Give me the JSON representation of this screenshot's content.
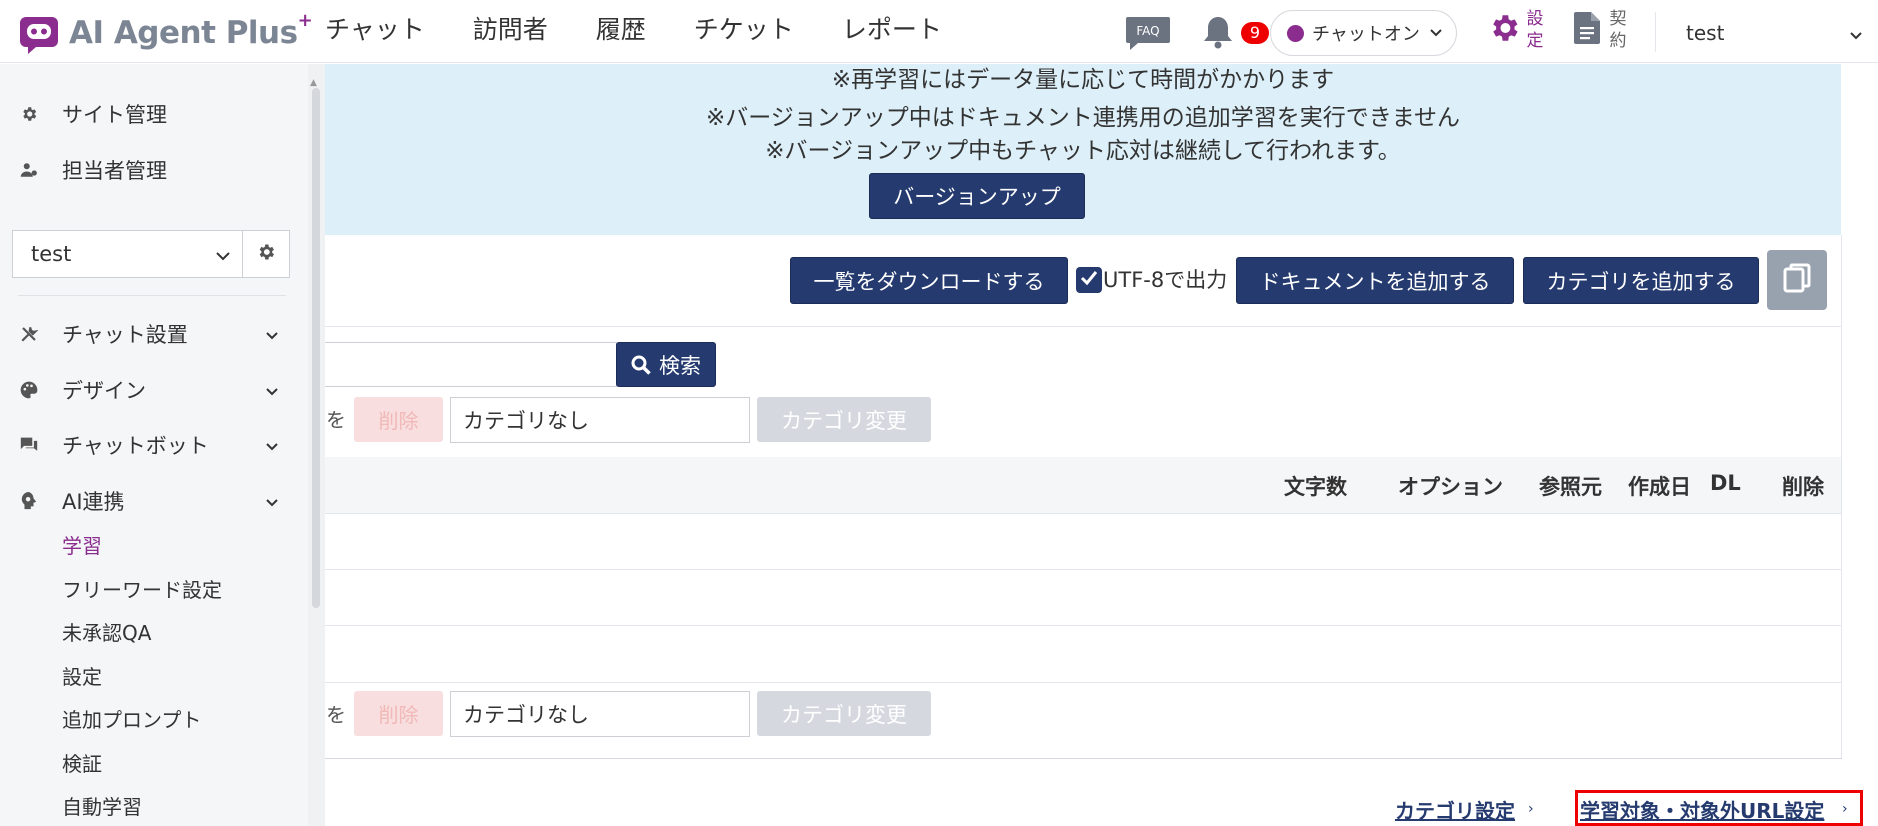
{
  "header": {
    "logo_text": "AI Agent Plus",
    "logo_sup": "+",
    "nav": [
      "チャット",
      "訪問者",
      "履歴",
      "チケット",
      "レポート"
    ],
    "faq_label": "FAQ",
    "notification_count": "9",
    "chat_status": "チャットオン",
    "settings_label": [
      "設",
      "定"
    ],
    "contract_label": [
      "契",
      "約"
    ],
    "user": "test",
    "brand_color": "#8a2d8f"
  },
  "sidebar": {
    "top_items": [
      {
        "label": "サイト管理",
        "icon": "gear-icon"
      },
      {
        "label": "担当者管理",
        "icon": "user-gear-icon"
      }
    ],
    "site_select": "test",
    "items": [
      {
        "label": "チャット設置",
        "icon": "tools-icon"
      },
      {
        "label": "デザイン",
        "icon": "palette-icon"
      },
      {
        "label": "チャットボット",
        "icon": "chat-bubble-icon"
      },
      {
        "label": "AI連携",
        "icon": "brain-icon"
      }
    ],
    "sub_items": [
      "学習",
      "フリーワード設定",
      "未承認QA",
      "設定",
      "追加プロンプト",
      "検証",
      "自動学習"
    ],
    "active_sub": "学習"
  },
  "banner": {
    "lines": [
      "※再学習にはデータ量に応じて時間がかかります",
      "※バージョンアップ中はドキュメント連携用の追加学習を実行できません",
      "※バージョンアップ中もチャット応対は継続して行われます。"
    ],
    "button": "バージョンアップ"
  },
  "toolbar": {
    "download": "一覧をダウンロードする",
    "utf8_label": "UTF-8で出力",
    "utf8_checked": true,
    "add_document": "ドキュメントを追加する",
    "add_category": "カテゴリを追加する"
  },
  "search": {
    "button": "検索"
  },
  "bulk": {
    "prefix": "を",
    "delete": "削除",
    "category_select": "カテゴリなし",
    "change_category": "カテゴリ変更"
  },
  "table": {
    "columns": [
      "文字数",
      "オプション",
      "参照元",
      "作成日",
      "DL",
      "削除"
    ]
  },
  "footer_links": {
    "category_settings": "カテゴリ設定",
    "url_settings": "学習対象・対象外URL設定"
  }
}
